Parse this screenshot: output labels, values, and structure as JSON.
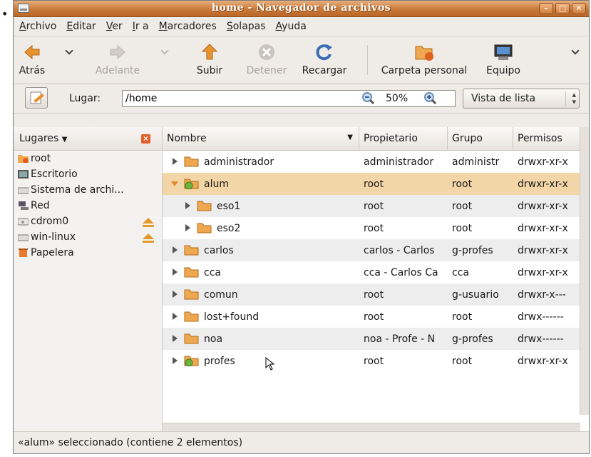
{
  "window": {
    "title": "home - Navegador de archivos",
    "minimize_label": "–",
    "maximize_label": "□",
    "close_label": "✕"
  },
  "menu": [
    "Archivo",
    "Editar",
    "Ver",
    "Ir a",
    "Marcadores",
    "Solapas",
    "Ayuda"
  ],
  "toolbar": {
    "back": "Atrás",
    "forward": "Adelante",
    "up": "Subir",
    "stop": "Detener",
    "reload": "Recargar",
    "home": "Carpeta personal",
    "computer": "Equipo"
  },
  "location": {
    "label": "Lugar:",
    "value": "/home",
    "zoom": "50%",
    "view": "Vista de lista"
  },
  "sidebar": {
    "header": "Lugares",
    "items": [
      {
        "label": "root",
        "icon": "home-folder-icon"
      },
      {
        "label": "Escritorio",
        "icon": "desktop-icon"
      },
      {
        "label": "Sistema de archi...",
        "icon": "drive-icon"
      },
      {
        "label": "Red",
        "icon": "network-icon"
      },
      {
        "label": "cdrom0",
        "icon": "cdrom-icon"
      },
      {
        "label": "win-linux",
        "icon": "drive-icon"
      },
      {
        "label": "Papelera",
        "icon": "trash-icon"
      }
    ]
  },
  "filelist": {
    "columns": [
      "Nombre",
      "Propietario",
      "Grupo",
      "Permisos"
    ],
    "rows": [
      {
        "name": "administrador",
        "owner": "administrador",
        "group": "administr",
        "perms": "drwxr-xr-x"
      },
      {
        "name": "alum",
        "owner": "root",
        "group": "root",
        "perms": "drwxr-xr-x"
      },
      {
        "name": "eso1",
        "owner": "root",
        "group": "root",
        "perms": "drwxr-xr-x"
      },
      {
        "name": "eso2",
        "owner": "root",
        "group": "root",
        "perms": "drwxr-xr-x"
      },
      {
        "name": "carlos",
        "owner": "carlos - Carlos",
        "group": "g-profes",
        "perms": "drwxr-xr-x"
      },
      {
        "name": "cca",
        "owner": "cca - Carlos Ca",
        "group": "cca",
        "perms": "drwxr-xr-x"
      },
      {
        "name": "comun",
        "owner": "root",
        "group": "g-usuario",
        "perms": "drwxr-x---"
      },
      {
        "name": "lost+found",
        "owner": "root",
        "group": "root",
        "perms": "drwx------"
      },
      {
        "name": "noa",
        "owner": "noa - Profe - N",
        "group": "g-profes",
        "perms": "drwx------"
      },
      {
        "name": "profes",
        "owner": "root",
        "group": "root",
        "perms": "drwxr-xr-x"
      }
    ]
  },
  "status": "«alum» seleccionado (contiene 2 elementos)",
  "colors": {
    "titlebar": "#c97938",
    "selected_row": "#f3d6a8",
    "folder": "#f0a850",
    "shared_folder": "#6db33f"
  }
}
